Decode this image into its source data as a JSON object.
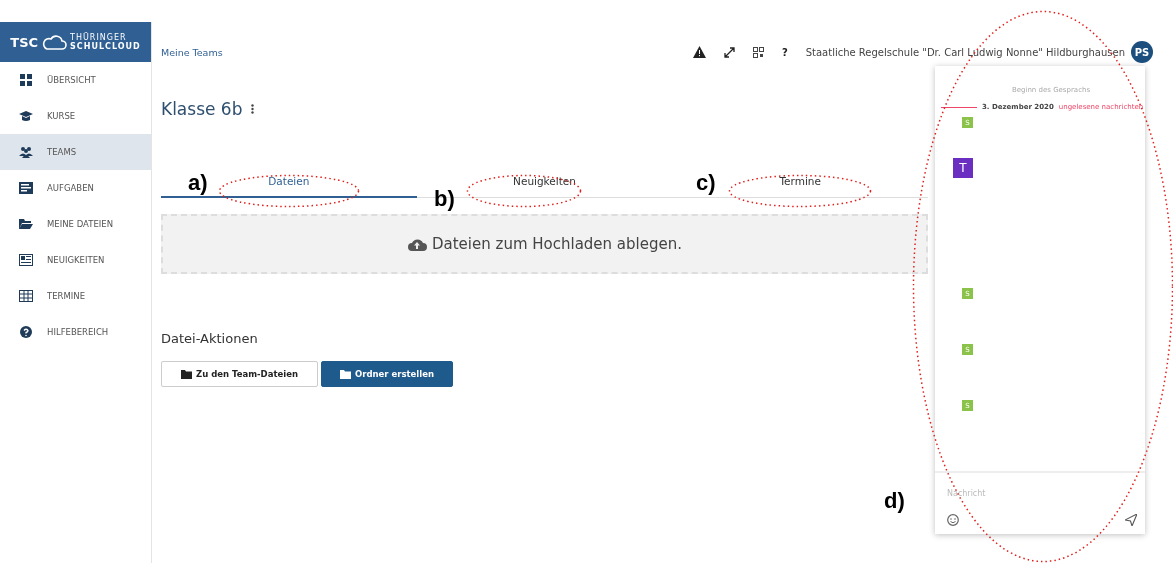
{
  "logo": {
    "short": "TSC",
    "line_1": "THÜRINGER",
    "line_2": "SCHULCLOUD"
  },
  "sidebar": {
    "items": [
      {
        "label": "ÜBERSICHT",
        "selected": false
      },
      {
        "label": "KURSE",
        "selected": false
      },
      {
        "label": "TEAMS",
        "selected": true
      },
      {
        "label": "AUFGABEN",
        "selected": false
      },
      {
        "label": "MEINE DATEIEN",
        "selected": false
      },
      {
        "label": "NEUIGKEITEN",
        "selected": false
      },
      {
        "label": "TERMINE",
        "selected": false
      },
      {
        "label": "HILFEBEREICH",
        "selected": false
      }
    ]
  },
  "breadcrumb": "Meine Teams",
  "header": {
    "help": "?",
    "school": "Staatliche Regelschule \"Dr. Carl Ludwig Nonne\" Hildburghausen",
    "avatar": "PS"
  },
  "title": "Klasse 6b",
  "tabs": [
    {
      "label": "Dateien",
      "selected": true
    },
    {
      "label": "Neuigkeiten",
      "selected": false
    },
    {
      "label": "Termine",
      "selected": false
    }
  ],
  "dropzone": "Dateien zum Hochladen ablegen.",
  "actions": {
    "heading": "Datei-Aktionen",
    "buttons": [
      {
        "label": "Zu den Team-Dateien",
        "kind": "secondary"
      },
      {
        "label": "Ordner erstellen",
        "kind": "primary"
      }
    ]
  },
  "chat": {
    "start": "Beginn des Gesprachs",
    "date": "3. Dezember 2020",
    "unread": "ungelesene nachrichten",
    "messages": [
      {
        "initial": "S",
        "color": "#8bc34a",
        "kind": "small"
      },
      {
        "initial": "T",
        "color": "#6a2fc0",
        "kind": "large"
      },
      {
        "initial": "S",
        "color": "#8bc34a",
        "kind": "small"
      },
      {
        "initial": "S",
        "color": "#8bc34a",
        "kind": "small"
      },
      {
        "initial": "S",
        "color": "#8bc34a",
        "kind": "small"
      }
    ],
    "placeholder": "Nachricht"
  },
  "annotations": [
    {
      "label": "a)"
    },
    {
      "label": "b)"
    },
    {
      "label": "c)"
    },
    {
      "label": "d)"
    }
  ]
}
